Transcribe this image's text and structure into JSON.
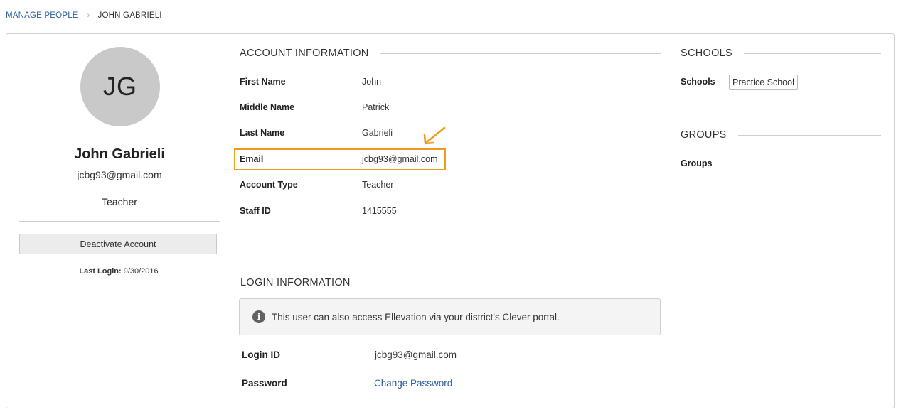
{
  "breadcrumb": {
    "parent": "MANAGE PEOPLE",
    "separator": "›",
    "current": "JOHN GABRIELI"
  },
  "profile": {
    "initials": "JG",
    "name": "John Gabrieli",
    "email": "jcbg93@gmail.com",
    "role": "Teacher",
    "deactivate_label": "Deactivate Account",
    "last_login_label": "Last Login:",
    "last_login_value": "9/30/2016"
  },
  "account_info": {
    "title": "ACCOUNT INFORMATION",
    "fields": [
      {
        "label": "First Name",
        "value": "John"
      },
      {
        "label": "Middle Name",
        "value": "Patrick"
      },
      {
        "label": "Last Name",
        "value": "Gabrieli"
      },
      {
        "label": "Email",
        "value": "jcbg93@gmail.com"
      },
      {
        "label": "Account Type",
        "value": "Teacher"
      },
      {
        "label": "Staff ID",
        "value": "1415555"
      }
    ]
  },
  "login_info": {
    "title": "LOGIN INFORMATION",
    "notice_icon": "info-icon",
    "notice": "This user can also access Ellevation via your district's Clever portal.",
    "login_id_label": "Login ID",
    "login_id_value": "jcbg93@gmail.com",
    "password_label": "Password",
    "password_link": "Change Password"
  },
  "schools": {
    "title": "SCHOOLS",
    "label": "Schools",
    "items": [
      "Practice School"
    ]
  },
  "groups": {
    "title": "GROUPS",
    "label": "Groups"
  },
  "colors": {
    "link": "#2a5d9c",
    "highlight": "#f39a1e",
    "avatar_bg": "#c9c9c9"
  }
}
